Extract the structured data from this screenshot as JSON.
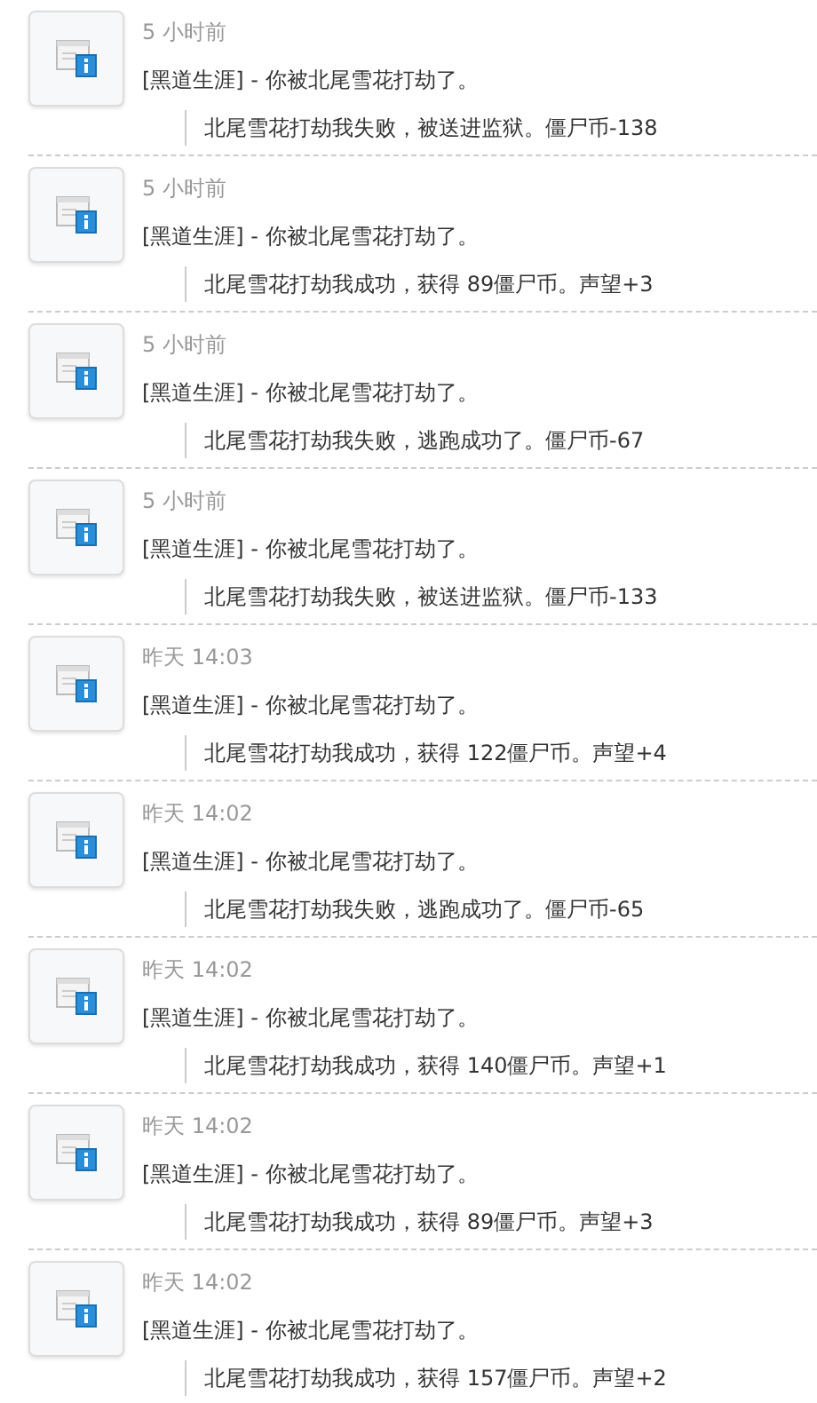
{
  "entries": [
    {
      "time": "5 小时前",
      "title": "[黑道生涯] - 你被北尾雪花打劫了。",
      "detail": "北尾雪花打劫我失败，被送进监狱。僵尸币-138"
    },
    {
      "time": "5 小时前",
      "title": "[黑道生涯] - 你被北尾雪花打劫了。",
      "detail": "北尾雪花打劫我成功，获得 89僵尸币。声望+3"
    },
    {
      "time": "5 小时前",
      "title": "[黑道生涯] - 你被北尾雪花打劫了。",
      "detail": "北尾雪花打劫我失败，逃跑成功了。僵尸币-67"
    },
    {
      "time": "5 小时前",
      "title": "[黑道生涯] - 你被北尾雪花打劫了。",
      "detail": "北尾雪花打劫我失败，被送进监狱。僵尸币-133"
    },
    {
      "time": "昨天 14:03",
      "title": "[黑道生涯] - 你被北尾雪花打劫了。",
      "detail": "北尾雪花打劫我成功，获得 122僵尸币。声望+4"
    },
    {
      "time": "昨天 14:02",
      "title": "[黑道生涯] - 你被北尾雪花打劫了。",
      "detail": "北尾雪花打劫我失败，逃跑成功了。僵尸币-65"
    },
    {
      "time": "昨天 14:02",
      "title": "[黑道生涯] - 你被北尾雪花打劫了。",
      "detail": "北尾雪花打劫我成功，获得 140僵尸币。声望+1"
    },
    {
      "time": "昨天 14:02",
      "title": "[黑道生涯] - 你被北尾雪花打劫了。",
      "detail": "北尾雪花打劫我成功，获得 89僵尸币。声望+3"
    },
    {
      "time": "昨天 14:02",
      "title": "[黑道生涯] - 你被北尾雪花打劫了。",
      "detail": "北尾雪花打劫我成功，获得 157僵尸币。声望+2"
    }
  ]
}
